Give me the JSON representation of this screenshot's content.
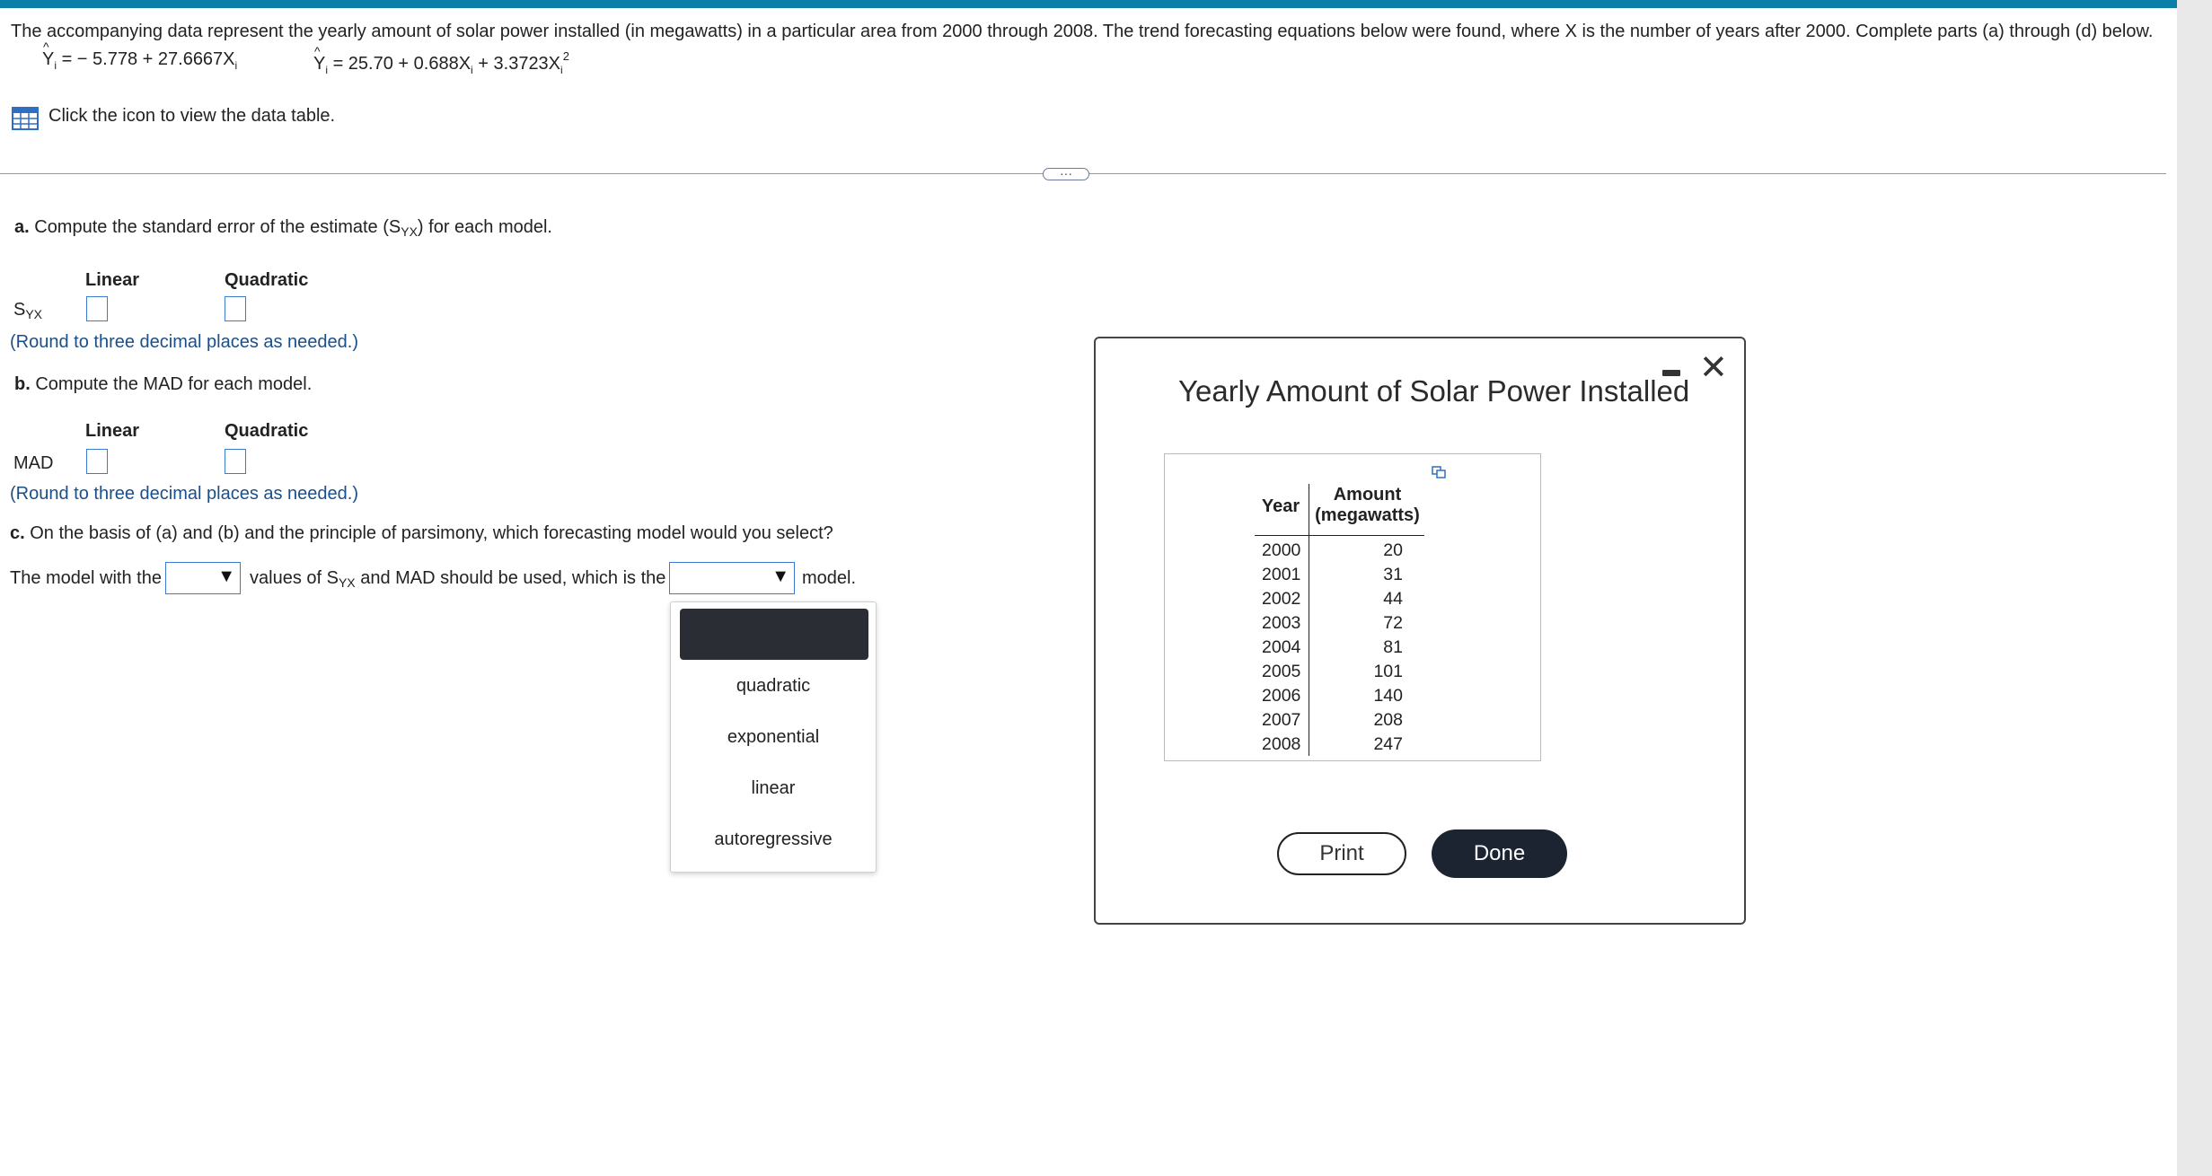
{
  "intro_text": "The accompanying data represent the yearly amount of solar power installed (in megawatts) in a particular area from 2000 through 2008. The trend forecasting equations below were found, where X is the number of years after 2000. Complete parts (a) through (d) below.",
  "equations": {
    "linear": {
      "lhs": "Y",
      "sub": "i",
      "rhs_a": " = − 5.778 + 27.6667X",
      "rhs_sub": "i"
    },
    "quadratic": {
      "lhs": "Y",
      "sub": "i",
      "rhs_a": " = 25.70 + 0.688X",
      "rhs_sub1": "i",
      "rhs_b": " + 3.3723X",
      "rhs_sub2": "i",
      "sup": "2"
    }
  },
  "data_table_link": "Click the icon to view the data table.",
  "ellipsis": "···",
  "part_a": {
    "label": "a.",
    "text_pre": " Compute the standard error of the estimate (S",
    "text_sub": "YX",
    "text_post": ") for each model.",
    "col_linear": "Linear",
    "col_quadratic": "Quadratic",
    "row_label": "S",
    "row_label_sub": "YX",
    "hint": "(Round to three decimal places as needed.)"
  },
  "part_b": {
    "label": "b.",
    "text": " Compute the MAD for each model.",
    "col_linear": "Linear",
    "col_quadratic": "Quadratic",
    "row_label": "MAD",
    "hint": "(Round to three decimal places as needed.)"
  },
  "part_c": {
    "label": "c.",
    "text": " On the basis of (a) and (b) and the principle of parsimony, which forecasting model would you select?",
    "sentence_1": "The model with the",
    "sentence_2a": "values of S",
    "sentence_2sub": "YX",
    "sentence_2b": " and MAD should be used, which is the",
    "sentence_3": "model.",
    "dropdown_options": [
      "quadratic",
      "exponential",
      "linear",
      "autoregressive"
    ]
  },
  "modal": {
    "title": "Yearly Amount of Solar Power Installed",
    "col_year": "Year",
    "col_amount_1": "Amount",
    "col_amount_2": "(megawatts)",
    "rows": [
      {
        "year": "2000",
        "amount": "20"
      },
      {
        "year": "2001",
        "amount": "31"
      },
      {
        "year": "2002",
        "amount": "44"
      },
      {
        "year": "2003",
        "amount": "72"
      },
      {
        "year": "2004",
        "amount": "81"
      },
      {
        "year": "2005",
        "amount": "101"
      },
      {
        "year": "2006",
        "amount": "140"
      },
      {
        "year": "2007",
        "amount": "208"
      },
      {
        "year": "2008",
        "amount": "247"
      }
    ],
    "print_label": "Print",
    "done_label": "Done",
    "close_glyph": "✕"
  },
  "colors": {
    "accent_bar": "#0a7fa8",
    "input_border": "#3b7bd1",
    "hint_text": "#1a4f8a",
    "done_bg": "#1b2430"
  }
}
